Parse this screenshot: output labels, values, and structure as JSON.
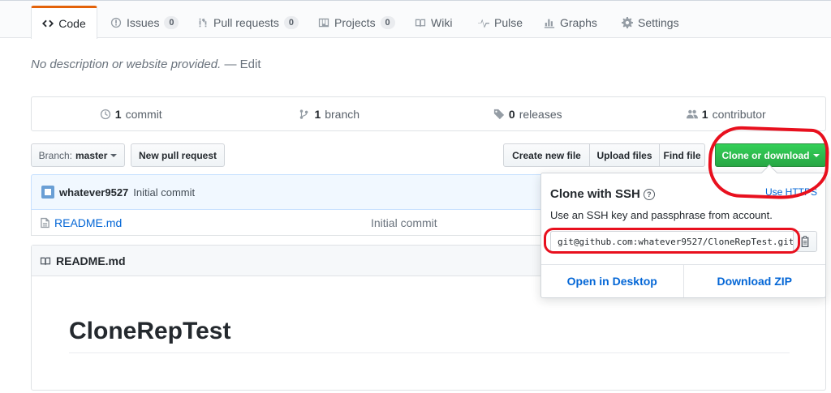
{
  "tabs": [
    {
      "label": "Code",
      "icon": "code-icon"
    },
    {
      "label": "Issues",
      "icon": "issue-icon",
      "count": "0"
    },
    {
      "label": "Pull requests",
      "icon": "pull-request-icon",
      "count": "0"
    },
    {
      "label": "Projects",
      "icon": "project-icon",
      "count": "0"
    },
    {
      "label": "Wiki",
      "icon": "book-icon"
    },
    {
      "label": "Pulse",
      "icon": "pulse-icon"
    },
    {
      "label": "Graphs",
      "icon": "graph-icon"
    },
    {
      "label": "Settings",
      "icon": "gear-icon"
    }
  ],
  "description": {
    "text": "No description or website provided.",
    "sep": "—",
    "edit": "Edit"
  },
  "summary": {
    "commits": {
      "num": "1",
      "label": "commit"
    },
    "branches": {
      "num": "1",
      "label": "branch"
    },
    "releases": {
      "num": "0",
      "label": "releases"
    },
    "contributors": {
      "num": "1",
      "label": "contributor"
    }
  },
  "toolbar": {
    "branch_prefix": "Branch:",
    "branch_name": "master",
    "new_pr": "New pull request",
    "create_file": "Create new file",
    "upload_files": "Upload files",
    "find_file": "Find file",
    "clone": "Clone or download"
  },
  "commit": {
    "author": "whatever9527",
    "message": "Initial commit"
  },
  "files": [
    {
      "name": "README.md",
      "message": "Initial commit"
    }
  ],
  "readme": {
    "header": "README.md",
    "title": "CloneRepTest"
  },
  "clone_popover": {
    "title": "Clone with SSH",
    "help": "?",
    "switch": "Use HTTPS",
    "desc": "Use an SSH key and passphrase from account.",
    "url": "git@github.com:whatever9527/CloneRepTest.git",
    "open_desktop": "Open in Desktop",
    "download_zip": "Download ZIP"
  },
  "colors": {
    "accent_tab": "#e36209",
    "clone_green": "#28a745",
    "link": "#0366d6",
    "annotation_red": "#e8101e"
  }
}
